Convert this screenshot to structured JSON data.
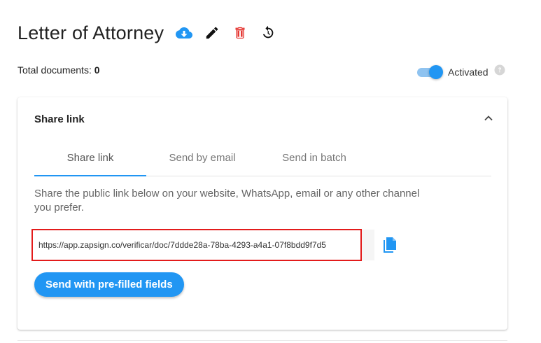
{
  "header": {
    "title": "Letter of Attorney",
    "actions": [
      {
        "icon": "cloud-download-icon",
        "color": "#2196f3"
      },
      {
        "icon": "pencil-icon",
        "color": "#111111"
      },
      {
        "icon": "trash-icon",
        "color": "#e53935"
      },
      {
        "icon": "history-icon",
        "color": "#111111"
      }
    ]
  },
  "summary": {
    "total_label": "Total documents:",
    "total_value": "0"
  },
  "status": {
    "toggle_on": true,
    "label": "Activated",
    "help_icon": "question-circle-icon"
  },
  "card": {
    "title": "Share link",
    "collapse_icon": "chevron-up-icon",
    "tabs": [
      {
        "label": "Share link",
        "active": true
      },
      {
        "label": "Send by email",
        "active": false
      },
      {
        "label": "Send in batch",
        "active": false
      }
    ],
    "description": "Share the public link below on your website, WhatsApp, email or any other channel you prefer.",
    "link_value": "https://app.zapsign.co/verificar/doc/7ddde28a-78ba-4293-a4a1-07f8bdd9f7d5",
    "copy_icon": "copy-icon",
    "prefill_button": "Send with pre-filled fields"
  },
  "colors": {
    "accent": "#2196f3",
    "highlight_border": "#e31b1b",
    "danger": "#e53935"
  }
}
